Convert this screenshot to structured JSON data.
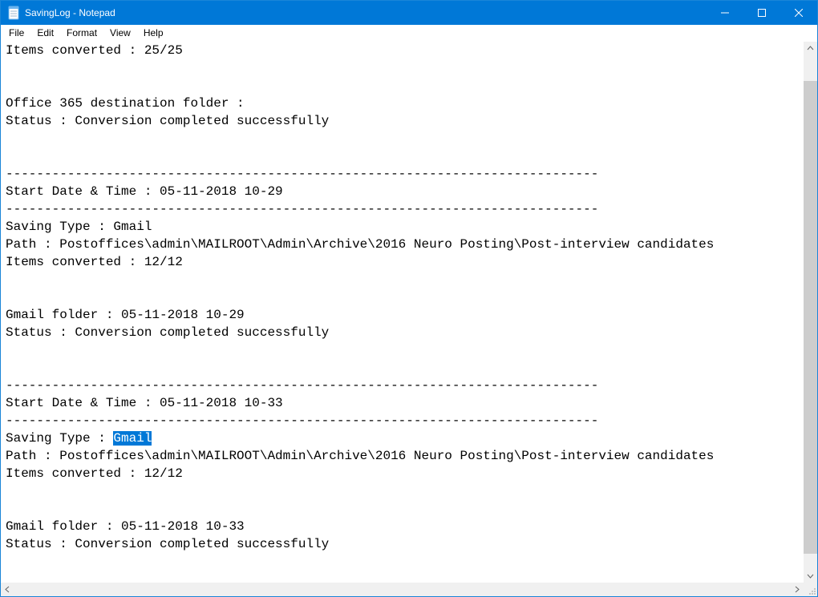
{
  "window": {
    "title": "SavingLog - Notepad"
  },
  "menu": {
    "file": "File",
    "edit": "Edit",
    "format": "Format",
    "view": "View",
    "help": "Help"
  },
  "document": {
    "line01": "Items converted : 25/25",
    "line02": "",
    "line03": "",
    "line04": "Office 365 destination folder :",
    "line05": "Status : Conversion completed successfully",
    "line06": "",
    "line07": "",
    "line08": "-----------------------------------------------------------------------------",
    "line09": "Start Date & Time : 05-11-2018 10-29",
    "line10": "-----------------------------------------------------------------------------",
    "line11": "Saving Type : Gmail",
    "line12": "Path : Postoffices\\admin\\MAILROOT\\Admin\\Archive\\2016 Neuro Posting\\Post-interview candidates",
    "line13": "Items converted : 12/12",
    "line14": "",
    "line15": "",
    "line16": "Gmail folder : 05-11-2018 10-29",
    "line17": "Status : Conversion completed successfully",
    "line18": "",
    "line19": "",
    "line20": "-----------------------------------------------------------------------------",
    "line21": "Start Date & Time : 05-11-2018 10-33",
    "line22": "-----------------------------------------------------------------------------",
    "line23_pre": "Saving Type : ",
    "line23_sel": "Gmail",
    "line24": "Path : Postoffices\\admin\\MAILROOT\\Admin\\Archive\\2016 Neuro Posting\\Post-interview candidates",
    "line25": "Items converted : 12/12",
    "line26": "",
    "line27": "",
    "line28": "Gmail folder : 05-11-2018 10-33",
    "line29": "Status : Conversion completed successfully"
  },
  "scrollbar": {
    "vthumb_top_pct": 5,
    "vthumb_height_pct": 92
  }
}
